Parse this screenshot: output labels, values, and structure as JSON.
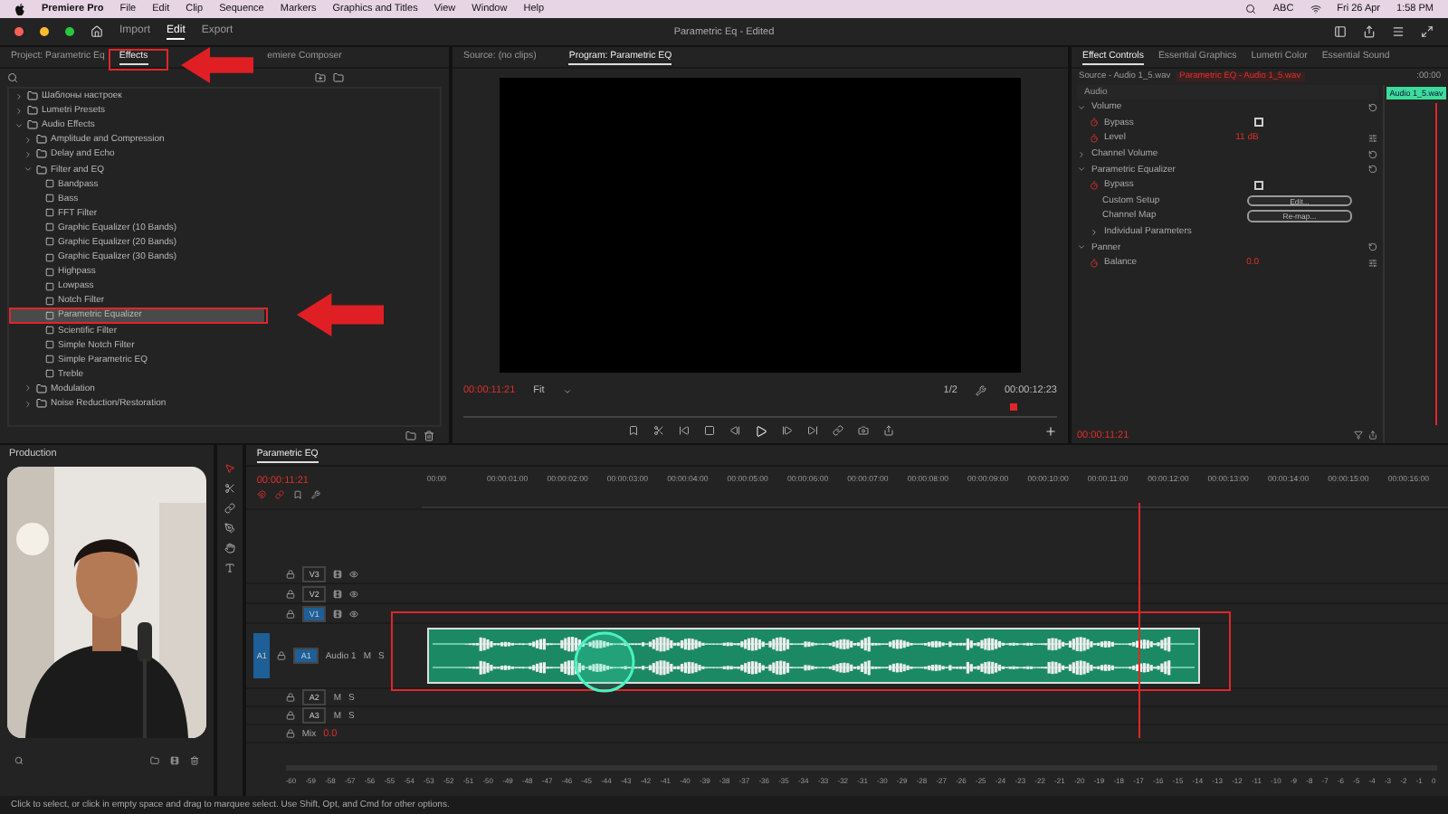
{
  "menubar": {
    "app": "Premiere Pro",
    "menus": [
      "File",
      "Edit",
      "Clip",
      "Sequence",
      "Markers",
      "Graphics and Titles",
      "View",
      "Window",
      "Help"
    ],
    "input": "ABC",
    "date": "Fri 26 Apr",
    "time": "1:58 PM"
  },
  "app_bar": {
    "modes": [
      {
        "label": "Import",
        "selected": false
      },
      {
        "label": "Edit",
        "selected": true
      },
      {
        "label": "Export",
        "selected": false
      }
    ],
    "title": "Parametric Eq",
    "status": "- Edited"
  },
  "effects_panel": {
    "tabs": [
      {
        "label": "Project: Parametric Eq",
        "selected": false
      },
      {
        "label": "Effects",
        "selected": true
      },
      {
        "label": "emiere Composer",
        "selected": false
      }
    ],
    "tree": [
      {
        "kind": "folder",
        "label": "Шаблоны настроек",
        "expanded": false,
        "selected": false
      },
      {
        "kind": "folder",
        "label": "Lumetri Presets",
        "expanded": false,
        "selected": false
      },
      {
        "kind": "folder",
        "label": "Audio Effects",
        "expanded": true,
        "selected": false,
        "children": [
          {
            "kind": "folder",
            "label": "Amplitude and Compression",
            "expanded": false,
            "selected": false
          },
          {
            "kind": "folder",
            "label": "Delay and Echo",
            "expanded": false,
            "selected": false
          },
          {
            "kind": "folder",
            "label": "Filter and EQ",
            "expanded": true,
            "selected": false,
            "children": [
              {
                "kind": "effect",
                "label": "Bandpass",
                "selected": false
              },
              {
                "kind": "effect",
                "label": "Bass",
                "selected": false
              },
              {
                "kind": "effect",
                "label": "FFT Filter",
                "selected": false
              },
              {
                "kind": "effect",
                "label": "Graphic Equalizer (10 Bands)",
                "selected": false
              },
              {
                "kind": "effect",
                "label": "Graphic Equalizer (20 Bands)",
                "selected": false
              },
              {
                "kind": "effect",
                "label": "Graphic Equalizer (30 Bands)",
                "selected": false
              },
              {
                "kind": "effect",
                "label": "Highpass",
                "selected": false
              },
              {
                "kind": "effect",
                "label": "Lowpass",
                "selected": false
              },
              {
                "kind": "effect",
                "label": "Notch Filter",
                "selected": false
              },
              {
                "kind": "effect",
                "label": "Parametric Equalizer",
                "selected": true
              },
              {
                "kind": "effect",
                "label": "Scientific Filter",
                "selected": false
              },
              {
                "kind": "effect",
                "label": "Simple Notch Filter",
                "selected": false
              },
              {
                "kind": "effect",
                "label": "Simple Parametric EQ",
                "selected": false
              },
              {
                "kind": "effect",
                "label": "Treble",
                "selected": false
              }
            ]
          },
          {
            "kind": "folder",
            "label": "Modulation",
            "expanded": false,
            "selected": false
          },
          {
            "kind": "folder",
            "label": "Noise Reduction/Restoration",
            "expanded": false,
            "selected": false
          }
        ]
      }
    ]
  },
  "program_monitor": {
    "tabs": [
      {
        "label": "Source: (no clips)",
        "selected": false
      },
      {
        "label": "Program: Parametric EQ",
        "selected": true
      }
    ],
    "timecode": "00:00:11:21",
    "zoom": "Fit",
    "resolution": "1/2",
    "duration": "00:00:12:23"
  },
  "effect_controls": {
    "tabs": [
      {
        "label": "Effect Controls",
        "selected": true
      },
      {
        "label": "Essential Graphics",
        "selected": false
      },
      {
        "label": "Lumetri Color",
        "selected": false
      },
      {
        "label": "Essential Sound",
        "selected": false
      }
    ],
    "source": "Source - Audio 1_5.wav",
    "clip": "Parametric EQ - Audio 1_5.wav",
    "time": ":00:00",
    "clip_label": "Audio 1_5.wav",
    "section": "Audio",
    "rows": [
      {
        "kind": "group",
        "label": "Volume",
        "expanded": true
      },
      {
        "kind": "checkbox",
        "label": "Bypass",
        "checked": false
      },
      {
        "kind": "value",
        "label": "Level",
        "value": "11 dB"
      },
      {
        "kind": "group",
        "label": "Channel Volume",
        "expanded": false
      },
      {
        "kind": "group",
        "label": "Parametric Equalizer",
        "expanded": true
      },
      {
        "kind": "checkbox",
        "label": "Bypass",
        "checked": false
      },
      {
        "kind": "button",
        "label": "Custom Setup",
        "button": "Edit..."
      },
      {
        "kind": "button",
        "label": "Channel Map",
        "button": "Re-map..."
      },
      {
        "kind": "sub",
        "label": "Individual Parameters"
      },
      {
        "kind": "group",
        "label": "Panner",
        "expanded": true
      },
      {
        "kind": "value",
        "label": "Balance",
        "value": "0.0"
      }
    ],
    "timecode": "00:00:11:21"
  },
  "production": {
    "title": "Production"
  },
  "timeline": {
    "tab": "Parametric EQ",
    "timecode": "00:00:11:21",
    "ruler": [
      "00:00",
      "00:00:01:00",
      "00:00:02:00",
      "00:00:03:00",
      "00:00:04:00",
      "00:00:05:00",
      "00:00:06:00",
      "00:00:07:00",
      "00:00:08:00",
      "00:00:09:00",
      "00:00:10:00",
      "00:00:11:00",
      "00:00:12:00",
      "00:00:13:00",
      "00:00:14:00",
      "00:00:15:00",
      "00:00:16:00"
    ],
    "tracks": [
      {
        "kind": "video",
        "name": "V3",
        "targeted": false
      },
      {
        "kind": "video",
        "name": "V2",
        "targeted": false
      },
      {
        "kind": "video",
        "name": "V1",
        "targeted": true
      },
      {
        "kind": "audio",
        "name": "A1",
        "label": "Audio 1",
        "source_patch": "A1",
        "mute": "M",
        "solo": "S",
        "targeted": true
      },
      {
        "kind": "audio",
        "name": "A2",
        "mute": "M",
        "solo": "S",
        "targeted": false
      },
      {
        "kind": "audio",
        "name": "A3",
        "mute": "M",
        "solo": "S",
        "targeted": false
      },
      {
        "kind": "mix",
        "name": "Mix",
        "value": "0.0"
      }
    ]
  },
  "meter": {
    "scale": [
      "-60",
      "-59",
      "-58",
      "-57",
      "-56",
      "-55",
      "-54",
      "-53",
      "-52",
      "-51",
      "-50",
      "-49",
      "-48",
      "-47",
      "-46",
      "-45",
      "-44",
      "-43",
      "-42",
      "-41",
      "-40",
      "-39",
      "-38",
      "-37",
      "-36",
      "-35",
      "-34",
      "-33",
      "-32",
      "-31",
      "-30",
      "-29",
      "-28",
      "-27",
      "-26",
      "-25",
      "-24",
      "-23",
      "-22",
      "-21",
      "-20",
      "-19",
      "-18",
      "-17",
      "-16",
      "-15",
      "-14",
      "-13",
      "-12",
      "-11",
      "-10",
      "-9",
      "-8",
      "-7",
      "-6",
      "-5",
      "-4",
      "-3",
      "-2",
      "-1",
      "0"
    ]
  },
  "status_bar": "Click to select, or click in empty space and drag to marquee select. Use Shift, Opt, and Cmd for other options."
}
